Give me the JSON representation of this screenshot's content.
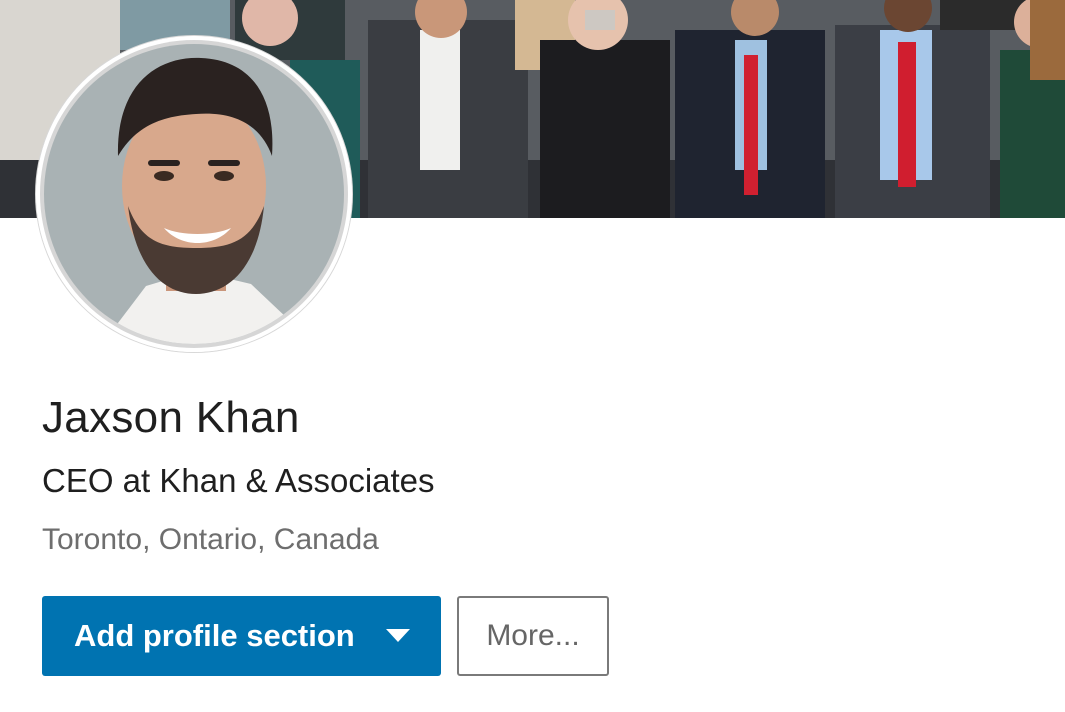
{
  "profile": {
    "name": "Jaxson Khan",
    "headline": "CEO at Khan & Associates",
    "location": "Toronto, Ontario, Canada"
  },
  "actions": {
    "add_section_label": "Add profile section",
    "add_section_icon": "caret-down-icon",
    "more_label": "More..."
  },
  "images": {
    "cover": "group-photo-background",
    "avatar": "profile-photo"
  },
  "colors": {
    "primary_button": "#0073b1",
    "name_text": "#1f1f1f",
    "location_text": "#6e6e6e",
    "more_border": "#7a7a7a"
  }
}
